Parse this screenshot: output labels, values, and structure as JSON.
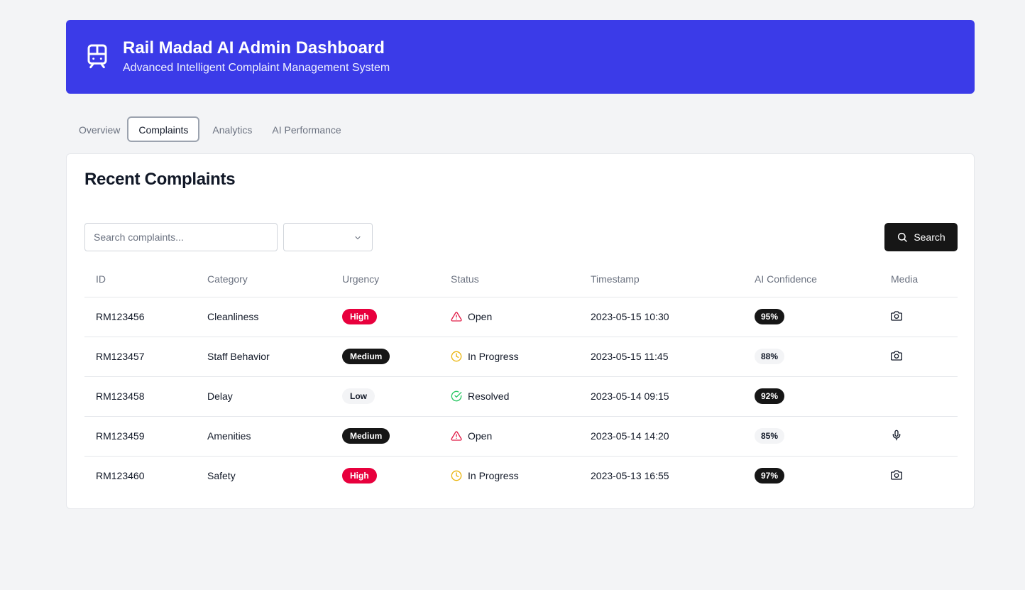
{
  "header": {
    "title": "Rail Madad AI Admin Dashboard",
    "subtitle": "Advanced Intelligent Complaint Management System",
    "icon": "train-icon",
    "bg_color": "#3b3be8"
  },
  "tabs": [
    {
      "label": "Overview",
      "active": false
    },
    {
      "label": "Complaints",
      "active": true
    },
    {
      "label": "Analytics",
      "active": false
    },
    {
      "label": "AI Performance",
      "active": false
    }
  ],
  "complaints": {
    "title": "Recent Complaints",
    "search": {
      "placeholder": "Search complaints...",
      "value": ""
    },
    "filter": {
      "selected": ""
    },
    "search_button": "Search",
    "columns": [
      "ID",
      "Category",
      "Urgency",
      "Status",
      "Timestamp",
      "AI Confidence",
      "Media"
    ],
    "rows": [
      {
        "id": "RM123456",
        "category": "Cleanliness",
        "urgency": "High",
        "status": "Open",
        "timestamp": "2023-05-15 10:30",
        "confidence": "95%",
        "confidence_style": "dark",
        "media": "camera-icon"
      },
      {
        "id": "RM123457",
        "category": "Staff Behavior",
        "urgency": "Medium",
        "status": "In Progress",
        "timestamp": "2023-05-15 11:45",
        "confidence": "88%",
        "confidence_style": "light",
        "media": "camera-icon"
      },
      {
        "id": "RM123458",
        "category": "Delay",
        "urgency": "Low",
        "status": "Resolved",
        "timestamp": "2023-05-14 09:15",
        "confidence": "92%",
        "confidence_style": "dark",
        "media": ""
      },
      {
        "id": "RM123459",
        "category": "Amenities",
        "urgency": "Medium",
        "status": "Open",
        "timestamp": "2023-05-14 14:20",
        "confidence": "85%",
        "confidence_style": "light",
        "media": "microphone-icon"
      },
      {
        "id": "RM123460",
        "category": "Safety",
        "urgency": "High",
        "status": "In Progress",
        "timestamp": "2023-05-13 16:55",
        "confidence": "97%",
        "confidence_style": "dark",
        "media": "camera-icon"
      }
    ]
  },
  "colors": {
    "urgency_high": "#e8003d",
    "urgency_medium": "#161616",
    "urgency_low": "#f3f4f6",
    "status_open": "#e11d48",
    "status_in_progress": "#eab308",
    "status_resolved": "#22c55e"
  }
}
